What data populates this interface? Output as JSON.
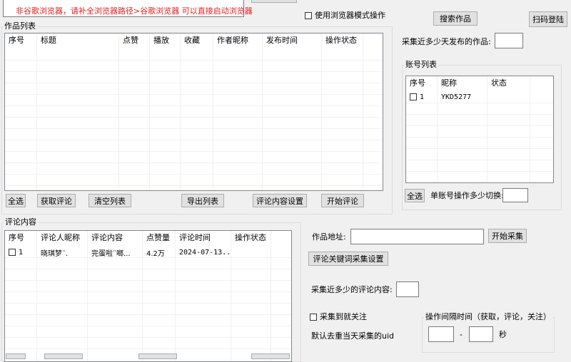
{
  "top": {
    "warning": "非谷歌浏览器，请补全浏览器路径>谷歌浏览器 可以直接启动浏览器",
    "browser_mode_label": "使用浏览器模式操作",
    "search_works_btn": "搜索作品",
    "scan_login_btn": "扫码登陆"
  },
  "works": {
    "group_title": "作品列表",
    "columns": [
      "序号",
      "标题",
      "点赞",
      "播放",
      "收藏",
      "作者昵称",
      "发布时间",
      "操作状态"
    ],
    "buttons": {
      "select_all": "全选",
      "get_comments": "获取评论",
      "clear_list": "清空列表",
      "export_list": "导出列表",
      "comment_settings": "评论内容设置",
      "start_comment": "开始评论"
    }
  },
  "collect_days": {
    "label": "采集近多少天发布的作品:",
    "value": ""
  },
  "accounts": {
    "group_title": "账号列表",
    "columns": [
      "序号",
      "昵称",
      "状态"
    ],
    "rows": [
      {
        "index": "1",
        "nickname": "YKD5277",
        "status": ""
      }
    ],
    "select_all": "全选",
    "switch_label": "单账号操作多少切换:",
    "switch_value": ""
  },
  "comments": {
    "group_title": "评论内容",
    "columns": [
      "序号",
      "评论人昵称",
      "评论内容",
      "点赞量",
      "评论时间",
      "操作状态"
    ],
    "rows": [
      {
        "index": "1",
        "nickname": "晓琪梦¨.",
        "content": "完蛋啦¨啷...",
        "likes": "4.2万",
        "time": "2024-07-13...",
        "status": ""
      }
    ]
  },
  "collect": {
    "work_url_label": "作品地址:",
    "work_url_value": "",
    "start_collect_btn": "开始采集",
    "keyword_settings_btn": "评论关键词采集设置",
    "comment_days_label": "采集近多少的评论内容:",
    "comment_days_value": "",
    "follow_label": "采集到就关注",
    "dedupe_label": "默认去重当天采集的uid",
    "interval_title": "操作间隔时间（获取，评论，关注）",
    "interval_dash": "-",
    "interval_unit": "秒",
    "interval_min": "",
    "interval_max": ""
  }
}
